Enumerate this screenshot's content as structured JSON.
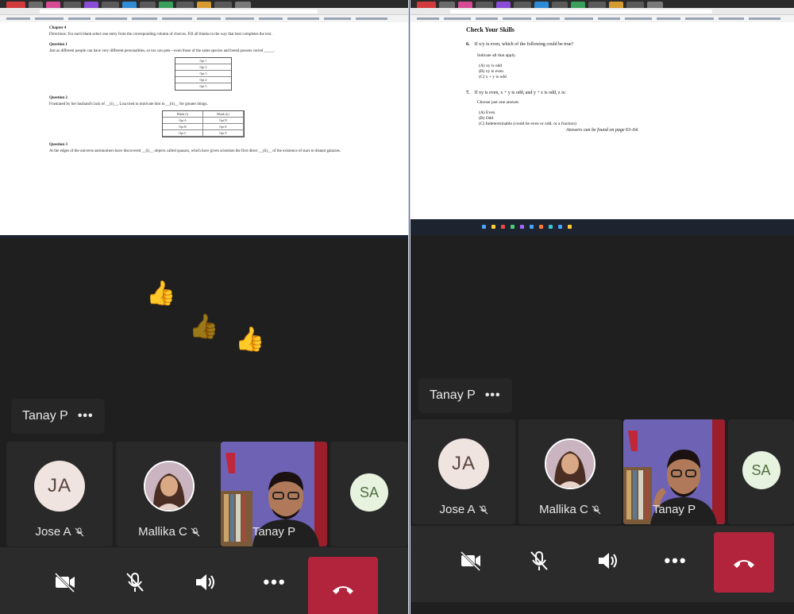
{
  "left_call": {
    "presenter_chip": {
      "name": "Tanay P",
      "more": "•••"
    },
    "shared_doc": {
      "section_title": "Chapter 4",
      "directions": "Directions: For each blank select one entry from the corresponding column of choices. Fill all blanks in the way that best completes the text.",
      "questions": [
        {
          "heading": "Question 1",
          "text": "Just as different people can have very different personalities, so too can pets—even those of the same species and breed possess varied _____.",
          "options": [
            "Opt 1",
            "Opt 2",
            "Opt 3",
            "Opt 4",
            "Opt 5"
          ]
        },
        {
          "heading": "Question 2",
          "text": "Frustrated by her husband's lack of __(i)__, Lisa tried to motivate him to __(ii)__ for greater things.",
          "options": [
            "Blank (i)",
            "Blank (ii)",
            "Opt A",
            "Opt D",
            "Opt B",
            "Opt E",
            "Opt C",
            "Opt F"
          ]
        },
        {
          "heading": "Question 3",
          "text": "At the edges of the universe astronomers have discovered __(i)__ objects called quasars, which have given scientists the first direct __(ii)__ of the existence of stars in distant galaxies."
        }
      ]
    },
    "reactions": [
      "👍",
      "👍",
      "👍"
    ],
    "participants": [
      {
        "name": "Jose A",
        "initials": "JA",
        "muted": true
      },
      {
        "name": "Mallika C",
        "muted": true
      },
      {
        "name": "Tanay P"
      },
      {
        "initials": "SA"
      }
    ]
  },
  "right_call": {
    "presenter_chip": {
      "name": "Tanay P",
      "more": "•••"
    },
    "shared_doc": {
      "title": "Check Your Skills",
      "q6_number": "6.",
      "q6_text": "If x/y is even, which of the following could be true?",
      "q6_instruction": "Indicate all that apply.",
      "q6_choices": [
        "(A) xy is odd",
        "(B) xy is even",
        "(C) x + y is odd"
      ],
      "q7_number": "7.",
      "q7_text": "If xy is even, x + y is odd, and y + z is odd, z is:",
      "q7_instruction": "Choose just one answer.",
      "q7_choices": [
        "(A) Even",
        "(B) Odd",
        "(C) Indeterminable (could be even or odd, or a fraction)"
      ],
      "answer_note": "Answers can be found on page 63–64."
    },
    "participants": [
      {
        "name": "Jose A",
        "initials": "JA",
        "muted": true
      },
      {
        "name": "Mallika C",
        "muted": true
      },
      {
        "name": "Tanay P"
      },
      {
        "initials": "SA"
      }
    ]
  },
  "controls": {
    "more_label": "•••"
  },
  "colors": {
    "hangup": "#b2243c",
    "active_speaker": "#6f7bd4",
    "call_bg": "#1f1f1f"
  }
}
